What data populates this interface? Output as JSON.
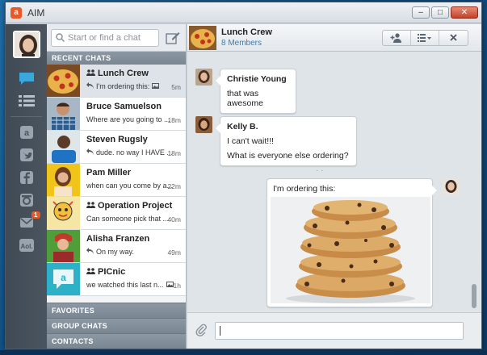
{
  "app": {
    "title": "AIM",
    "icon_letter": "a"
  },
  "window_buttons": [
    "–",
    "□",
    "✕"
  ],
  "search": {
    "placeholder": "Start or find a chat"
  },
  "sections": {
    "recent": "RECENT CHATS",
    "favorites": "FAVORITES",
    "group": "GROUP CHATS",
    "contacts": "CONTACTS"
  },
  "chats": [
    {
      "name": "Lunch Crew",
      "preview": "I'm ordering this:",
      "time": "5m",
      "group": true,
      "reply": true,
      "image": true,
      "thumb": "pizza"
    },
    {
      "name": "Bruce Samuelson",
      "preview": "Where are you going to ...",
      "time": "18m",
      "group": false,
      "reply": false,
      "image": false,
      "thumb": "man-plaid"
    },
    {
      "name": "Steven Rugsly",
      "preview": "dude. no way I HAVE ...",
      "time": "18m",
      "group": false,
      "reply": true,
      "image": false,
      "thumb": "man-blue"
    },
    {
      "name": "Pam Miller",
      "preview": "when can you come by a...",
      "time": "22m",
      "group": false,
      "reply": false,
      "image": false,
      "thumb": "woman-yellow"
    },
    {
      "name": "Operation Project",
      "preview": "Can someone pick that ...",
      "time": "40m",
      "group": true,
      "reply": false,
      "image": false,
      "thumb": "doodle"
    },
    {
      "name": "Alisha Franzen",
      "preview": "On my way.",
      "time": "49m",
      "group": false,
      "reply": true,
      "image": false,
      "thumb": "woman-green"
    },
    {
      "name": "PICnic",
      "preview": "we watched this last n...",
      "time": "1h",
      "group": true,
      "reply": false,
      "image": true,
      "thumb": "aim-logo"
    }
  ],
  "conversation": {
    "name": "Lunch Crew",
    "members": "8 Members",
    "messages": [
      {
        "sender": "Christie Young",
        "lines": [
          "that was awesome"
        ],
        "side": "left"
      },
      {
        "sender": "Kelly B.",
        "lines": [
          "I can't wait!!!",
          "What is everyone else ordering?"
        ],
        "side": "left"
      },
      {
        "sender": "",
        "lines": [
          "I'm ordering this:"
        ],
        "side": "right",
        "image": "cookies"
      }
    ],
    "separator": "· ·"
  },
  "rail": {
    "notification_count": "1"
  },
  "colors": {
    "accent": "#e8592a",
    "members_link": "#2f7fb8",
    "section_header": "#808c98"
  }
}
